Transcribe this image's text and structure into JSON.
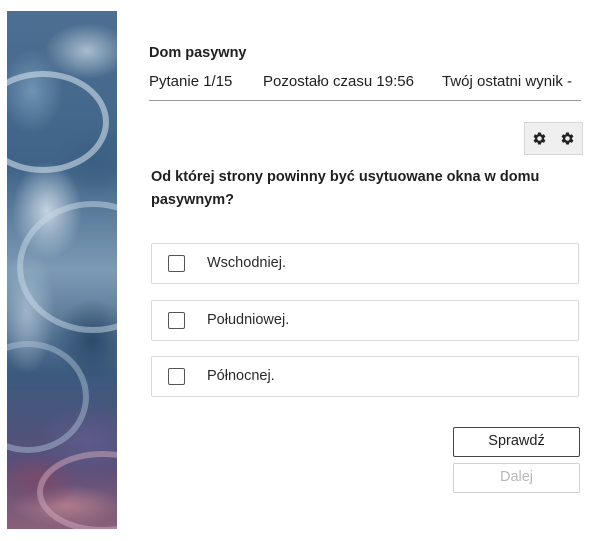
{
  "quiz": {
    "title": "Dom pasywny"
  },
  "status": {
    "question_counter": "Pytanie 1/15",
    "time_remaining": "Pozostało czasu 19:56",
    "last_score": "Twój ostatni wynik -"
  },
  "toolbar": {
    "icons": [
      "gear-icon",
      "gear-icon"
    ]
  },
  "question": {
    "text": "Od której strony powinny być usytuowane okna w domu pasywnym?",
    "answers": [
      {
        "label": "Wschodniej.",
        "checked": false
      },
      {
        "label": "Południowej.",
        "checked": false
      },
      {
        "label": "Północnej.",
        "checked": false
      }
    ]
  },
  "buttons": {
    "check_label": "Sprawdź",
    "next_label": "Dalej",
    "next_enabled": false
  }
}
